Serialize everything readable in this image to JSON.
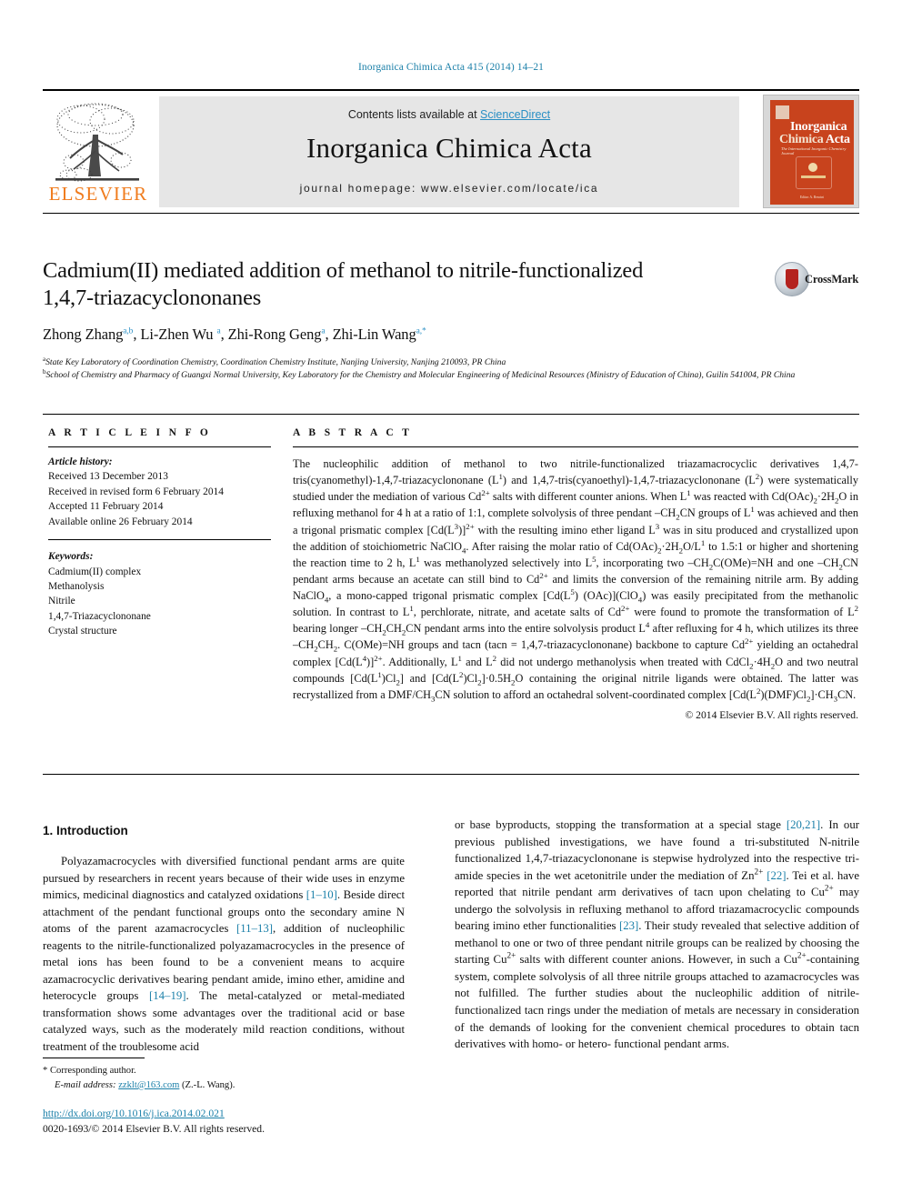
{
  "running_head": "Inorganica Chimica Acta 415 (2014) 14–21",
  "masthead": {
    "publisher_wordmark": "ELSEVIER",
    "contents_prefix": "Contents lists available at ",
    "contents_link": "ScienceDirect",
    "journal_title": "Inorganica Chimica Acta",
    "homepage": "journal homepage: www.elsevier.com/locate/ica",
    "cover": {
      "line1": "Inorganica",
      "line2": "Chimica",
      "line3": "Acta",
      "tagline": "The International Inorganic Chemistry Journal",
      "footer": "Editor: A. Bencini"
    }
  },
  "crossmark": {
    "label": "CrossMark"
  },
  "article": {
    "title_line1": "Cadmium(II) mediated addition of methanol to nitrile-functionalized",
    "title_line2": "1,4,7-triazacyclononanes",
    "authors": [
      {
        "name": "Zhong Zhang",
        "marks": "a,b"
      },
      {
        "name": "Li-Zhen Wu",
        "marks": "a"
      },
      {
        "name": "Zhi-Rong Geng",
        "marks": "a"
      },
      {
        "name": "Zhi-Lin Wang",
        "marks": "a,*"
      }
    ],
    "affiliations": [
      {
        "mark": "a",
        "text": "State Key Laboratory of Coordination Chemistry, Coordination Chemistry Institute, Nanjing University, Nanjing 210093, PR China"
      },
      {
        "mark": "b",
        "text": "School of Chemistry and Pharmacy of Guangxi Normal University, Key Laboratory for the Chemistry and Molecular Engineering of Medicinal Resources (Ministry of Education of China), Guilin 541004, PR China"
      }
    ]
  },
  "article_info": {
    "heading": "A R T I C L E   I N F O",
    "history_label": "Article history:",
    "history": [
      "Received 13 December 2013",
      "Received in revised form 6 February 2014",
      "Accepted 11 February 2014",
      "Available online 26 February 2014"
    ],
    "keywords_label": "Keywords:",
    "keywords": [
      "Cadmium(II) complex",
      "Methanolysis",
      "Nitrile",
      "1,4,7-Triazacyclononane",
      "Crystal structure"
    ]
  },
  "abstract": {
    "heading": "A B S T R A C T",
    "copyright": "© 2014 Elsevier B.V. All rights reserved."
  },
  "body": {
    "section_heading": "1. Introduction",
    "footnote_marker": "*",
    "footnote_corresponding": "Corresponding author.",
    "footnote_email_label": "E-mail address:",
    "footnote_email": "zzklt@163.com",
    "footnote_email_owner": "(Z.-L. Wang).",
    "doi": "http://dx.doi.org/10.1016/j.ica.2014.02.021",
    "issn": "0020-1693/© 2014 Elsevier B.V. All rights reserved."
  }
}
